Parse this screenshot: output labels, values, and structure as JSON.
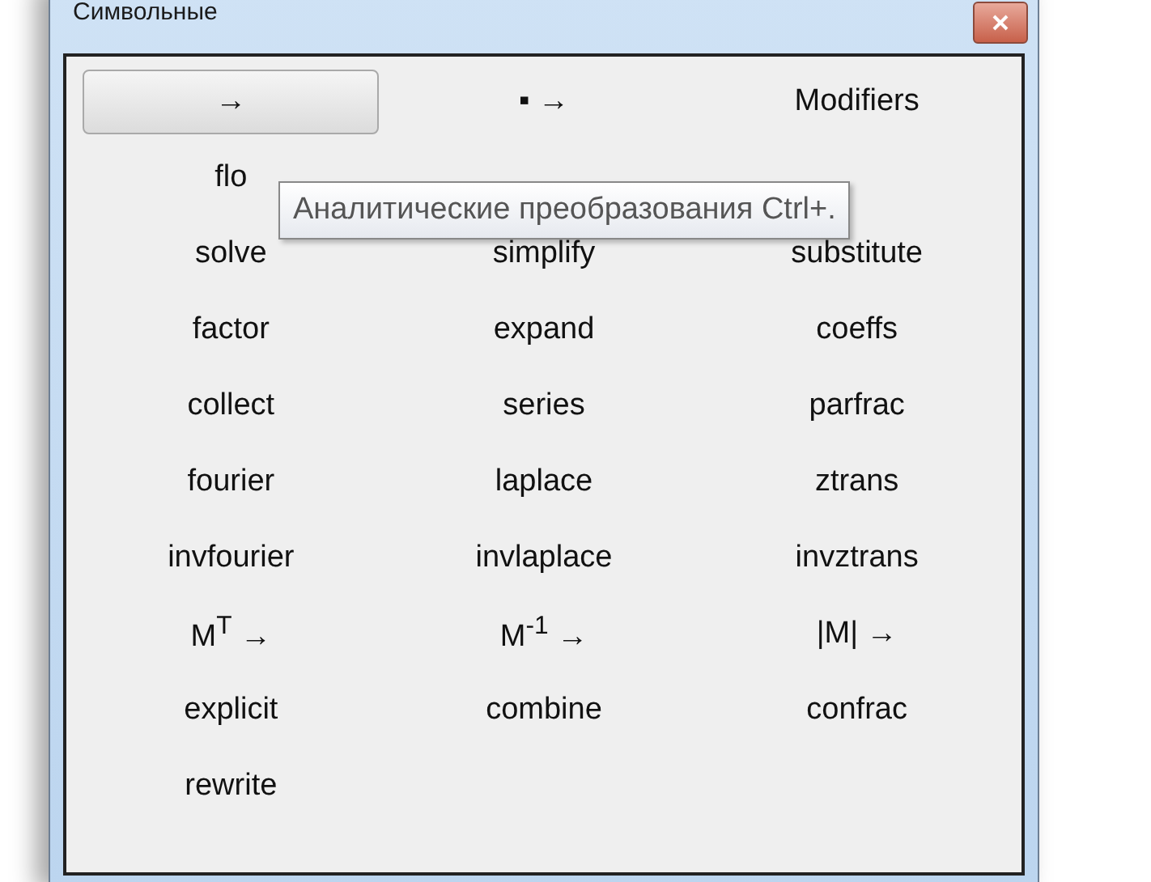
{
  "window": {
    "title": "Символьные"
  },
  "rows": [
    [
      {
        "label": "→",
        "highlighted": true
      },
      {
        "label": "▪ →",
        "highlighted": false
      },
      {
        "label": "Modifiers",
        "highlighted": false
      }
    ],
    [
      {
        "label": "flo",
        "highlighted": false
      }
    ],
    [
      {
        "label": "solve",
        "highlighted": false
      },
      {
        "label": "simplify",
        "highlighted": false
      },
      {
        "label": "substitute",
        "highlighted": false
      }
    ],
    [
      {
        "label": "factor",
        "highlighted": false
      },
      {
        "label": "expand",
        "highlighted": false
      },
      {
        "label": "coeffs",
        "highlighted": false
      }
    ],
    [
      {
        "label": "collect",
        "highlighted": false
      },
      {
        "label": "series",
        "highlighted": false
      },
      {
        "label": "parfrac",
        "highlighted": false
      }
    ],
    [
      {
        "label": "fourier",
        "highlighted": false
      },
      {
        "label": "laplace",
        "highlighted": false
      },
      {
        "label": "ztrans",
        "highlighted": false
      }
    ],
    [
      {
        "label": "invfourier",
        "highlighted": false
      },
      {
        "label": "invlaplace",
        "highlighted": false
      },
      {
        "label": "invztrans",
        "highlighted": false
      }
    ],
    [
      {
        "label": "M$^{T}$ →",
        "highlighted": false
      },
      {
        "label": "M$^{-1}$ →",
        "highlighted": false
      },
      {
        "label": "|M| →",
        "highlighted": false
      }
    ],
    [
      {
        "label": "explicit",
        "highlighted": false
      },
      {
        "label": "combine",
        "highlighted": false
      },
      {
        "label": "confrac",
        "highlighted": false
      }
    ],
    [
      {
        "label": "rewrite",
        "highlighted": false
      }
    ]
  ],
  "tooltip": "Аналитические преобразования Ctrl+."
}
